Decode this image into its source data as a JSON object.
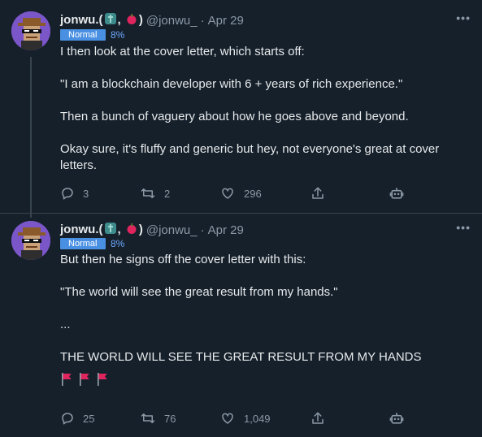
{
  "tweets": [
    {
      "display_name": "jonwu.(",
      "display_name_tail": ",",
      "display_name_end": ")",
      "handle": "@jonwu_",
      "dot": "·",
      "date": "Apr 29",
      "badge": "Normal",
      "percent": "8%",
      "paragraphs": [
        "I then look at the cover letter, which starts off:",
        "\"I am a blockchain developer with 6 + years of rich experience.\"",
        "Then a bunch of vaguery about how he goes above and beyond.",
        "Okay sure, it's fluffy and generic but hey, not everyone's great at cover letters."
      ],
      "replies": "3",
      "retweets": "2",
      "likes": "296"
    },
    {
      "display_name": "jonwu.(",
      "display_name_tail": ",",
      "display_name_end": ")",
      "handle": "@jonwu_",
      "dot": "·",
      "date": "Apr 29",
      "badge": "Normal",
      "percent": "8%",
      "paragraphs": [
        "But then he signs off the cover letter with this:",
        "\"The world will see the great result from my hands.\"",
        "...",
        "THE WORLD WILL SEE THE GREAT RESULT FROM MY HANDS"
      ],
      "flags": [
        "red-flag-icon",
        "red-flag-icon",
        "red-flag-icon"
      ],
      "replies": "25",
      "retweets": "76",
      "likes": "1,049"
    }
  ],
  "icons": {
    "more": "more-icon",
    "reply": "reply-icon",
    "retweet": "retweet-icon",
    "like": "heart-icon",
    "share": "share-icon",
    "bot": "robot-icon",
    "emoji_1": "statue-of-liberty-icon",
    "emoji_2": "apple-icon"
  },
  "colors": {
    "background": "#15202b",
    "text": "#e7e9ea",
    "muted": "#8b98a5",
    "badge": "#4a90e2",
    "flag": "#e0245e"
  }
}
